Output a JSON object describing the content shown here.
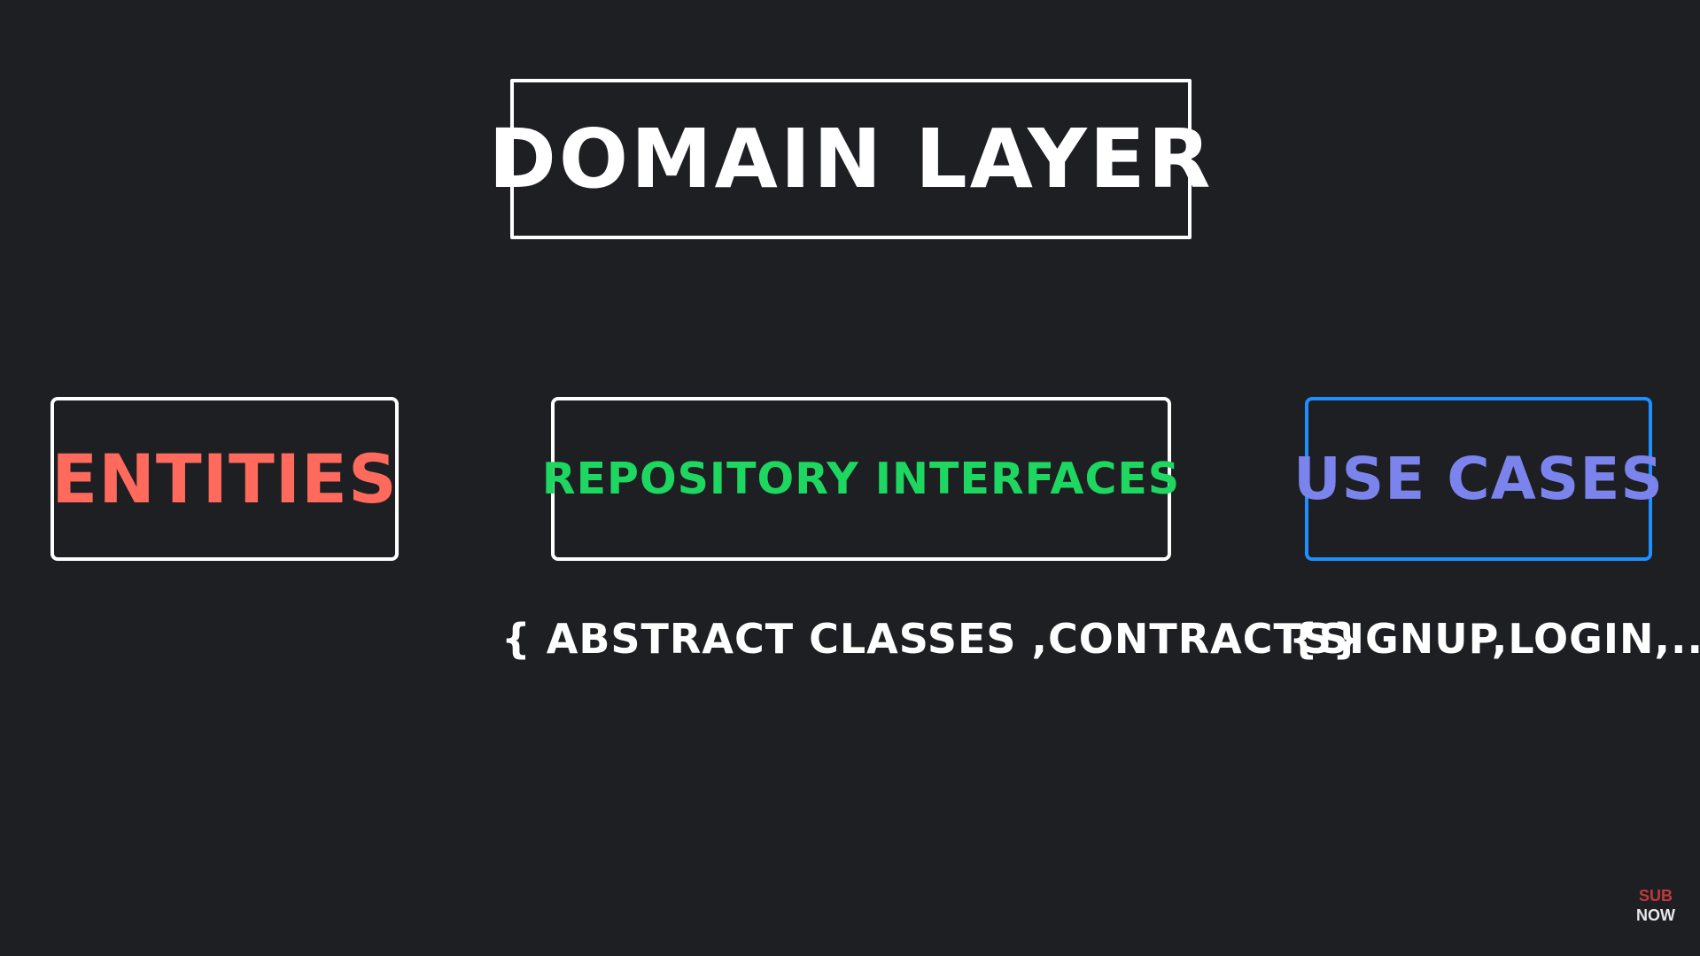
{
  "title": "DOMAIN LAYER",
  "boxes": [
    {
      "label": "ENTITIES",
      "text_color": "#ff6a5c",
      "border_color": "#ffffff"
    },
    {
      "label": "REPOSITORY INTERFACES",
      "text_color": "#1ed760",
      "border_color": "#ffffff"
    },
    {
      "label": "USE CASES",
      "text_color": "#7b83ec",
      "border_color": "#1e8fff"
    }
  ],
  "captions": {
    "repository": "{ ABSTRACT CLASSES ,CONTRACTS}",
    "use_cases": "{SIGNUP,LOGIN,...}"
  },
  "watermark": {
    "line1": "SUB",
    "line2": "NOW"
  },
  "colors": {
    "background": "#1e1f23",
    "title_text": "#ffffff",
    "caption_text": "#ffffff"
  }
}
